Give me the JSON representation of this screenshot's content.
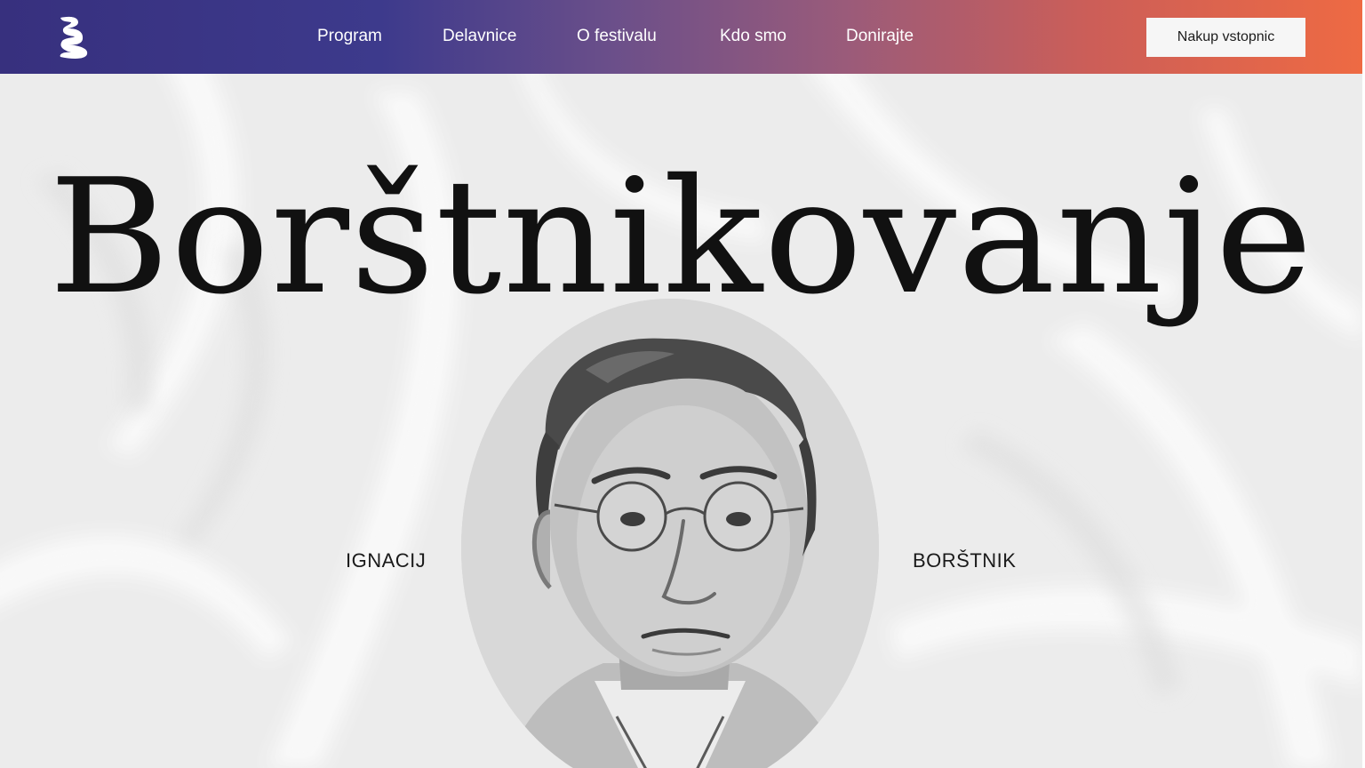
{
  "header": {
    "logo_icon": "festival-b-logo-icon",
    "nav": [
      {
        "label": "Program"
      },
      {
        "label": "Delavnice"
      },
      {
        "label": "O festivalu"
      },
      {
        "label": "Kdo smo"
      },
      {
        "label": "Donirajte"
      }
    ],
    "cta_label": "Nakup vstopnic",
    "gradient": [
      "#37307e",
      "#ee6a43"
    ]
  },
  "hero": {
    "title": "Borštnikovanje",
    "first_name": "IGNACIJ",
    "last_name": "BORŠTNIK",
    "portrait_icon": "ignacij-borstnik-portrait"
  }
}
